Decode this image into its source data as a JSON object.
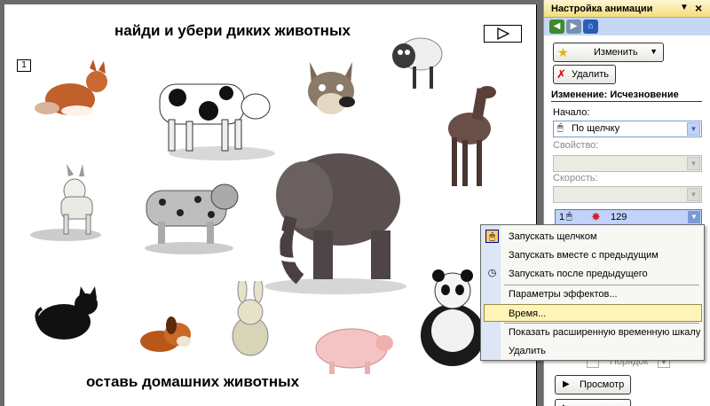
{
  "slide": {
    "title_top": "найди и убери диких животных",
    "title_bottom": "оставь домашних животных",
    "tag": "1",
    "play_icon": "play-triangle-icon"
  },
  "animals": [
    "fox",
    "cow",
    "wolf",
    "sheep",
    "goat",
    "leopard",
    "mammoth",
    "horse",
    "cat",
    "dog",
    "hare",
    "pig",
    "panda"
  ],
  "task_pane": {
    "title": "Настройка анимации",
    "change_label": "Изменить",
    "delete_label": "Удалить",
    "section_title": "Изменение: Исчезновение",
    "start_label": "Начало:",
    "start_value": "По щелчку",
    "property_label": "Свойство:",
    "speed_label": "Скорость:",
    "anim_item": {
      "number": "1",
      "name": "129"
    },
    "order_label": "Порядок",
    "preview_label": "Просмотр"
  },
  "context_menu": {
    "items": [
      {
        "label": "Запускать щелчком",
        "icon": "mouse-icon",
        "checked": true
      },
      {
        "label": "Запускать вместе с предыдущим",
        "icon": "",
        "checked": false
      },
      {
        "label": "Запускать после предыдущего",
        "icon": "clock-icon",
        "checked": false
      },
      {
        "label": "Параметры эффектов...",
        "icon": "",
        "checked": false
      },
      {
        "label": "Время...",
        "icon": "",
        "checked": false,
        "hover": true
      },
      {
        "label": "Показать расширенную временную шкалу",
        "icon": "",
        "checked": false
      },
      {
        "label": "Удалить",
        "icon": "",
        "checked": false
      }
    ]
  },
  "colors": {
    "pane_bg": "#c6d7f4",
    "header_gold": "#f4dd7a",
    "menu_hover": "#fff4b8",
    "selected_item": "#c1d3fb"
  }
}
